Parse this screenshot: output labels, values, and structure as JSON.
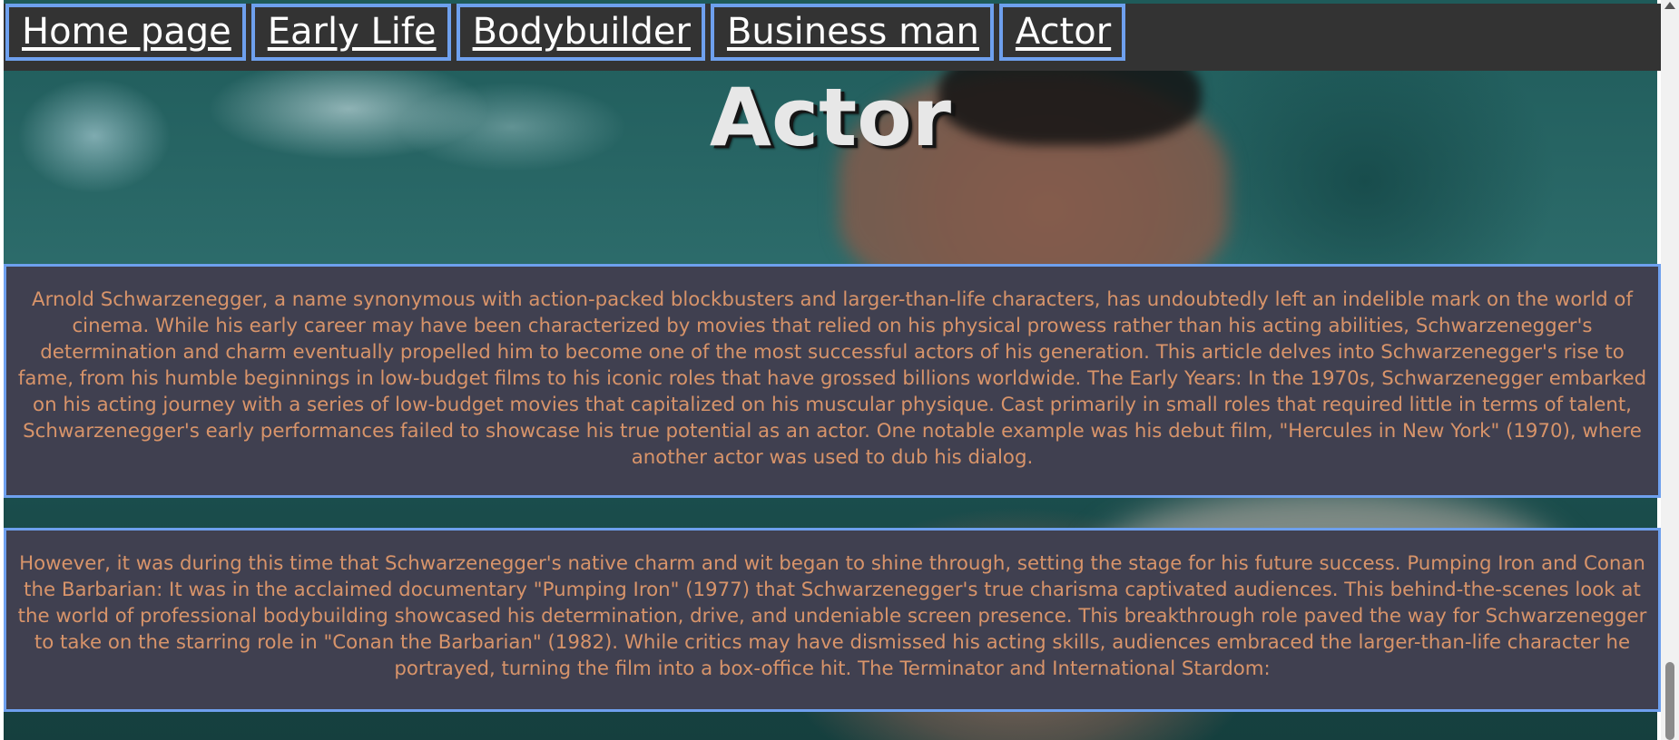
{
  "nav": {
    "items": [
      {
        "label": "Home page"
      },
      {
        "label": "Early Life"
      },
      {
        "label": "Bodybuilder"
      },
      {
        "label": "Business man"
      },
      {
        "label": "Actor"
      }
    ]
  },
  "heading": "Actor",
  "sections": [
    {
      "text": "Arnold Schwarzenegger, a name synonymous with action-packed blockbusters and larger-than-life characters, has undoubtedly left an indelible mark on the world of cinema. While his early career may have been characterized by movies that relied on his physical prowess rather than his acting abilities, Schwarzenegger's determination and charm eventually propelled him to become one of the most successful actors of his generation. This article delves into Schwarzenegger's rise to fame, from his humble beginnings in low-budget films to his iconic roles that have grossed billions worldwide. The Early Years: In the 1970s, Schwarzenegger embarked on his acting journey with a series of low-budget movies that capitalized on his muscular physique. Cast primarily in small roles that required little in terms of talent, Schwarzenegger's early performances failed to showcase his true potential as an actor. One notable example was his debut film, \"Hercules in New York\" (1970), where another actor was used to dub his dialog."
    },
    {
      "text": "However, it was during this time that Schwarzenegger's native charm and wit began to shine through, setting the stage for his future success. Pumping Iron and Conan the Barbarian: It was in the acclaimed documentary \"Pumping Iron\" (1977) that Schwarzenegger's true charisma captivated audiences. This behind-the-scenes look at the world of professional bodybuilding showcased his determination, drive, and undeniable screen presence. This breakthrough role paved the way for Schwarzenegger to take on the starring role in \"Conan the Barbarian\" (1982). While critics may have dismissed his acting skills, audiences embraced the larger-than-life character he portrayed, turning the film into a box-office hit. The Terminator and International Stardom:"
    }
  ],
  "colors": {
    "nav_background": "#333333",
    "nav_border": "#6ea0ee",
    "section_background": "#404050",
    "section_text": "#d8946a",
    "heading_text": "#e7e7e7"
  },
  "scrollbar": {
    "scroll_position": 1.0
  }
}
